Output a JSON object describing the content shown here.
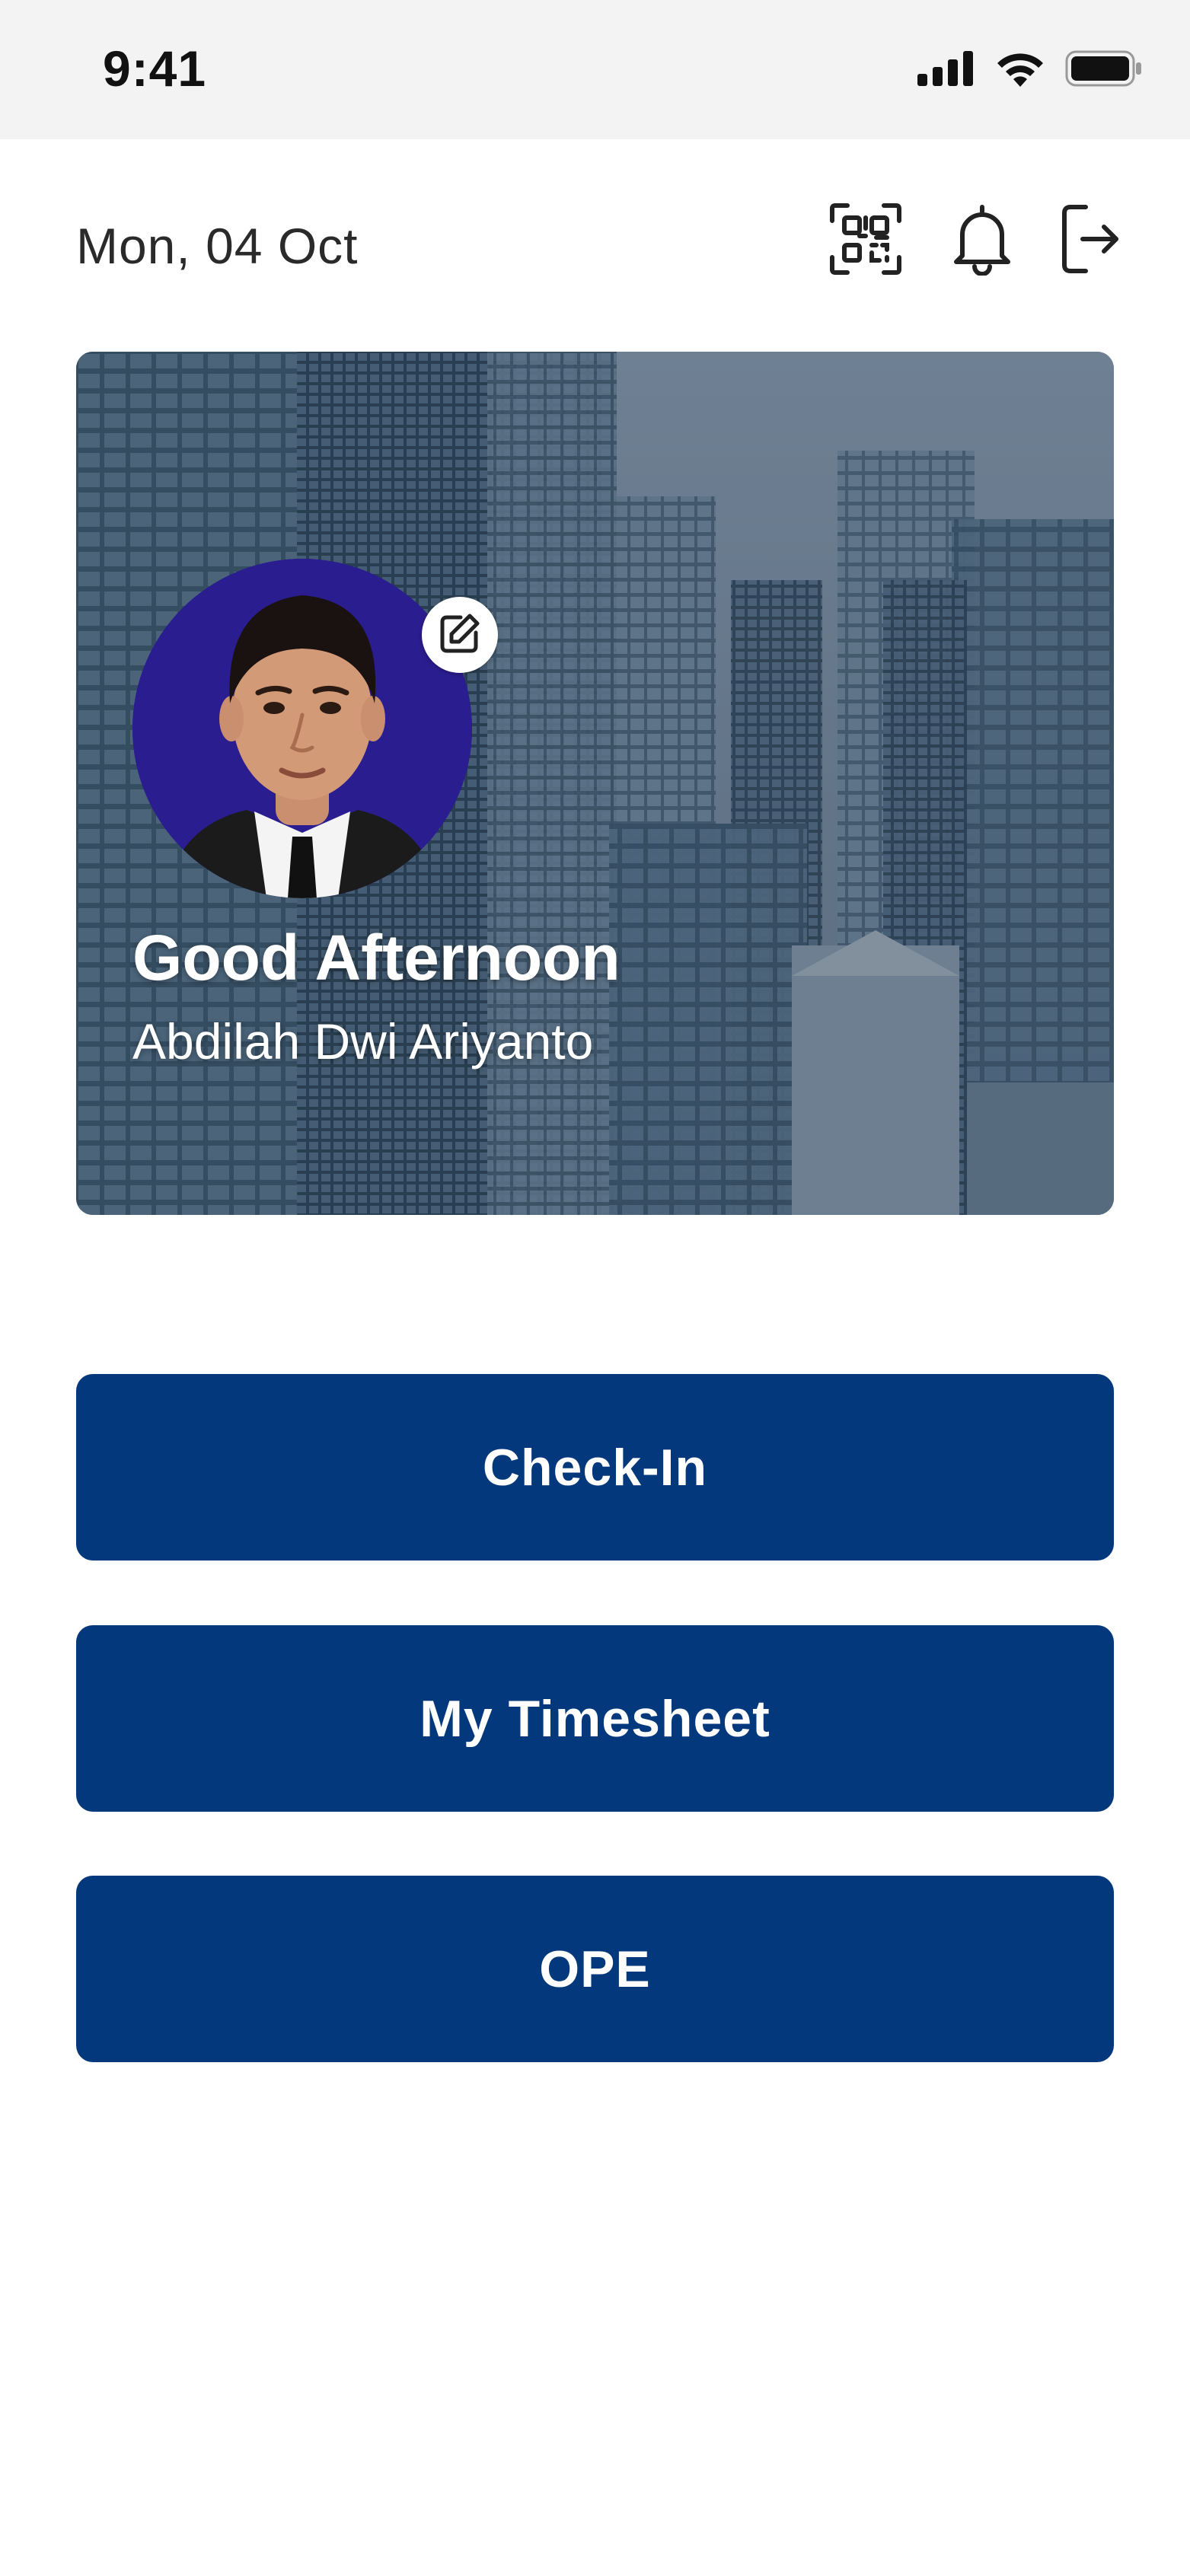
{
  "status_bar": {
    "time": "9:41",
    "icons": [
      "signal-icon",
      "wifi-icon",
      "battery-icon"
    ]
  },
  "header": {
    "date": "Mon, 04 Oct",
    "icons": [
      "qr-code-icon",
      "bell-icon",
      "logout-icon"
    ]
  },
  "hero": {
    "greeting": "Good Afternoon",
    "user_name": "Abdilah Dwi Ariyanto",
    "edit_icon": "edit-icon"
  },
  "actions": {
    "check_in_label": "Check-In",
    "timesheet_label": "My Timesheet",
    "ope_label": "OPE"
  },
  "colors": {
    "primary": "#03397c",
    "status_bar_bg": "#f3f3f3",
    "avatar_bg": "#2a1d8f",
    "text_dark": "#2a2a2a"
  }
}
